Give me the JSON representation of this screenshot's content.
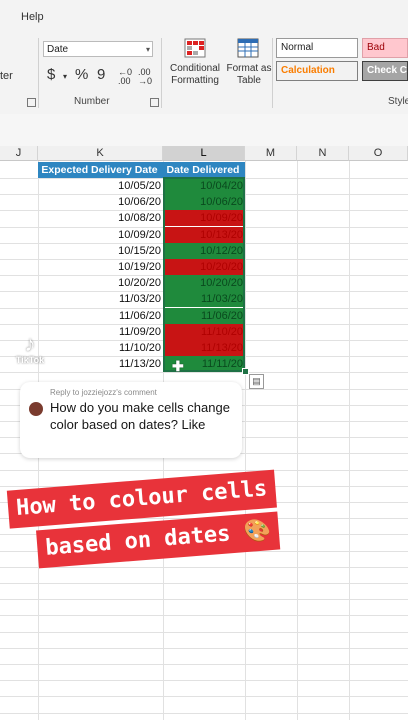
{
  "ribbon": {
    "menu_item": "Help",
    "cut_label": "ter",
    "number_format": "Date",
    "number_buttons": {
      "currency": "$",
      "percent": "%",
      "comma": "9"
    },
    "decimal_buttons": {
      "increase": "←0\n.00",
      "decrease": ".00\n→0"
    },
    "number_group_label": "Number",
    "conditional_formatting": "Conditional\nFormatting",
    "format_as_table": "Format as\nTable",
    "styles": {
      "normal": "Normal",
      "bad": "Bad",
      "calculation": "Calculation",
      "check_cell": "Check Ce"
    },
    "styles_group_label": "Style",
    "colors": {
      "bad_bg": "#ffc7ce",
      "bad_fg": "#9c0006",
      "calc_bg": "#f2f2f2",
      "calc_fg": "#fa7d00"
    }
  },
  "sheet": {
    "columns": [
      "J",
      "K",
      "L",
      "M",
      "N",
      "O"
    ],
    "headers": {
      "expected": "Expected Delivery Date",
      "delivered": "Date Delivered"
    },
    "header_bg": "#2e86c1",
    "rows": [
      {
        "expected": "10/05/20",
        "delivered": "10/04/20",
        "status": "ok"
      },
      {
        "expected": "10/06/20",
        "delivered": "10/06/20",
        "status": "ok"
      },
      {
        "expected": "10/08/20",
        "delivered": "10/09/20",
        "status": "late"
      },
      {
        "expected": "10/09/20",
        "delivered": "10/13/20",
        "status": "late"
      },
      {
        "expected": "10/15/20",
        "delivered": "10/12/20",
        "status": "ok"
      },
      {
        "expected": "10/19/20",
        "delivered": "10/20/20",
        "status": "late"
      },
      {
        "expected": "10/20/20",
        "delivered": "10/20/20",
        "status": "ok"
      },
      {
        "expected": "11/03/20",
        "delivered": "11/03/20",
        "status": "ok"
      },
      {
        "expected": "11/06/20",
        "delivered": "11/06/20",
        "status": "ok"
      },
      {
        "expected": "11/09/20",
        "delivered": "11/10/20",
        "status": "late"
      },
      {
        "expected": "11/10/20",
        "delivered": "11/13/20",
        "status": "late"
      },
      {
        "expected": "11/13/20",
        "delivered": "11/11/20",
        "status": "ok"
      }
    ],
    "status_colors": {
      "ok": "#1f8a3c",
      "late": "#c81414"
    }
  },
  "overlay": {
    "watermark": "TikTok",
    "comment_reply": "Reply to jozziejozz's comment",
    "comment_text": "How do you make cells change color based on dates? Like",
    "banner_line1": "How to colour cells",
    "banner_line2": "based on dates 🎨"
  }
}
